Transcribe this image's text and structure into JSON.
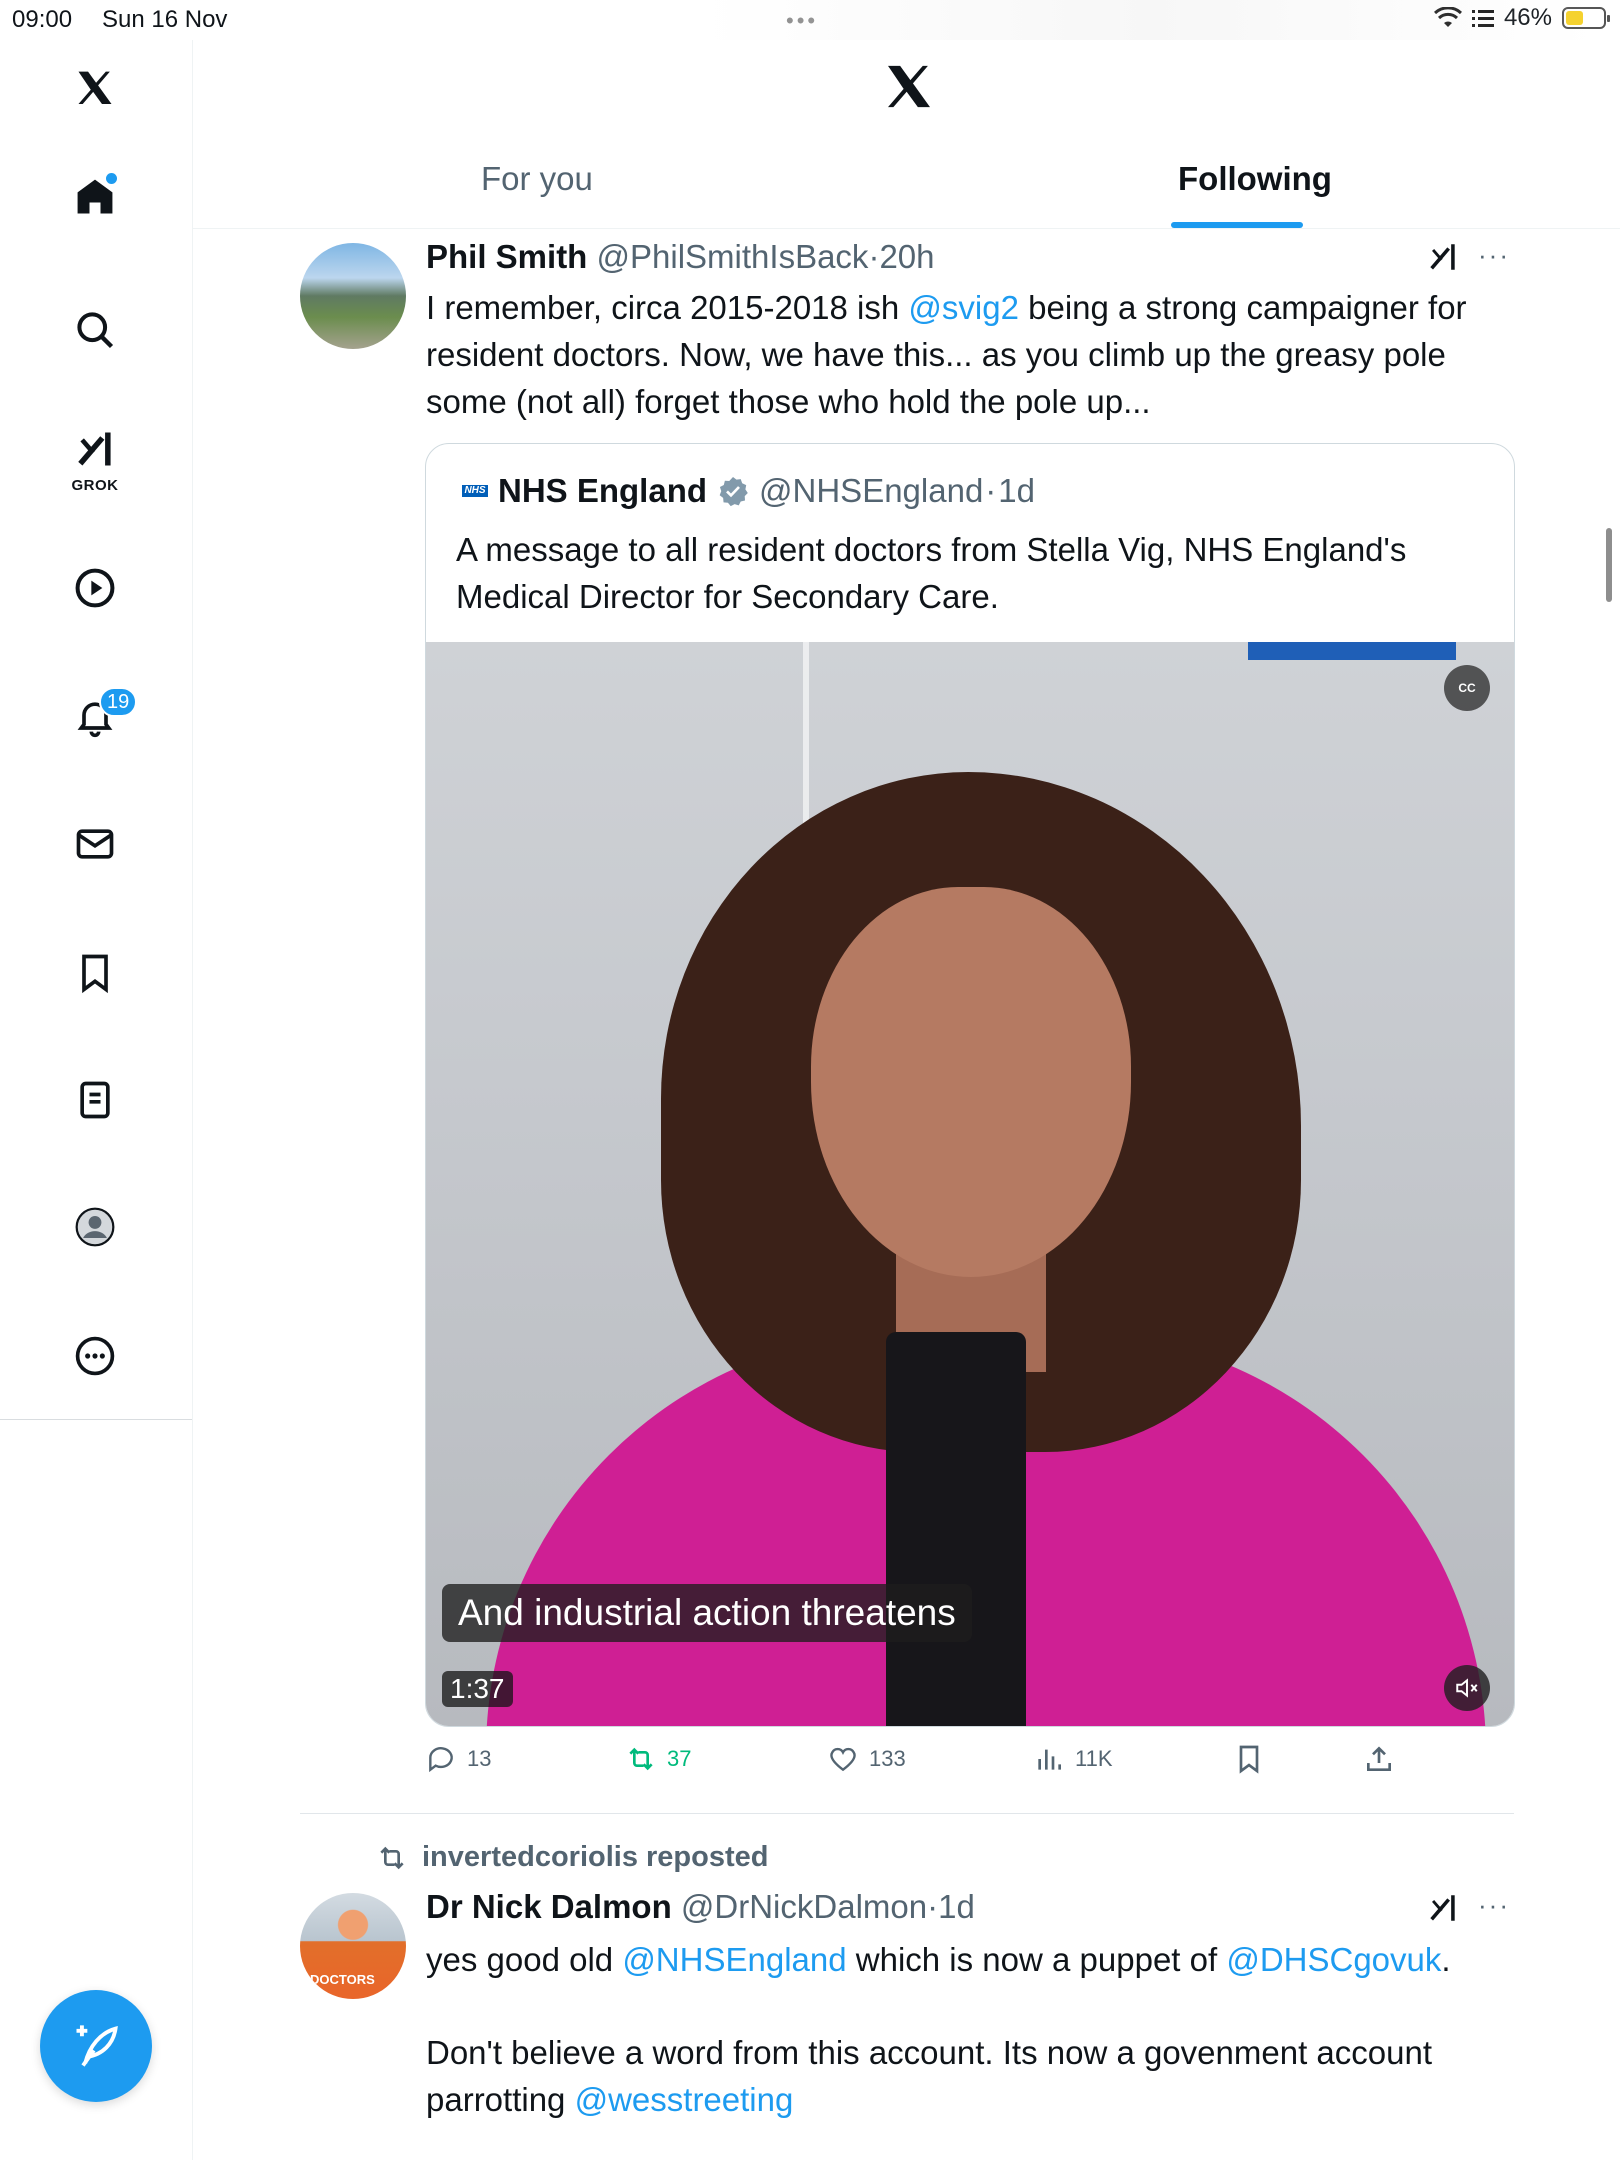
{
  "status_bar": {
    "time": "09:00",
    "date": "Sun 16 Nov",
    "battery": "46%",
    "battery_level": 0.46
  },
  "sidebar": {
    "items": [
      "x-logo",
      "home",
      "search",
      "grok",
      "video",
      "notifications",
      "messages",
      "bookmarks",
      "lists",
      "profile",
      "more"
    ],
    "grok_label": "GROK",
    "notifications_badge": "19"
  },
  "header": {
    "tabs": [
      {
        "label": "For you",
        "active": false
      },
      {
        "label": "Following",
        "active": true
      }
    ]
  },
  "tweets": [
    {
      "name": "Phil Smith",
      "handle": "@PhilSmithIsBack",
      "time": "20h",
      "text_1": "I remember, circa 2015-2018 ish ",
      "mention": "@svig2",
      "text_2": " being a strong campaigner for resident doctors. Now, we have this... as you climb up the greasy pole some (not all) forget those who hold the pole up...",
      "quote": {
        "logo_text": "NHS",
        "name": "NHS England",
        "handle": "@NHSEngland",
        "time": "1d",
        "text": "A message to all resident doctors from Stella Vig, NHS England's Medical Director for Secondary Care.",
        "video": {
          "caption": "And industrial action threatens",
          "duration": "1:37",
          "cc_label": "CC"
        }
      },
      "actions": {
        "replies": "13",
        "reposts": "37",
        "likes": "133",
        "views": "11K"
      }
    },
    {
      "reposted_by": "invertedcoriolis reposted",
      "avatar_text": "DOCTORS",
      "name": "Dr Nick Dalmon",
      "handle": "@DrNickDalmon",
      "time": "1d",
      "line1_a": "yes good old ",
      "line1_m1": "@NHSEngland",
      "line1_b": " which is now a puppet of ",
      "line1_m2": "@DHSCgovuk",
      "line1_c": ".",
      "line2": "Don't believe a word from this account. Its now a govenment account parrotting ",
      "line2_m": "@wesstreeting"
    }
  ],
  "colors": {
    "accent": "#1d9bf0",
    "repost_green": "#00ba7c",
    "secondary_text": "#536471"
  }
}
